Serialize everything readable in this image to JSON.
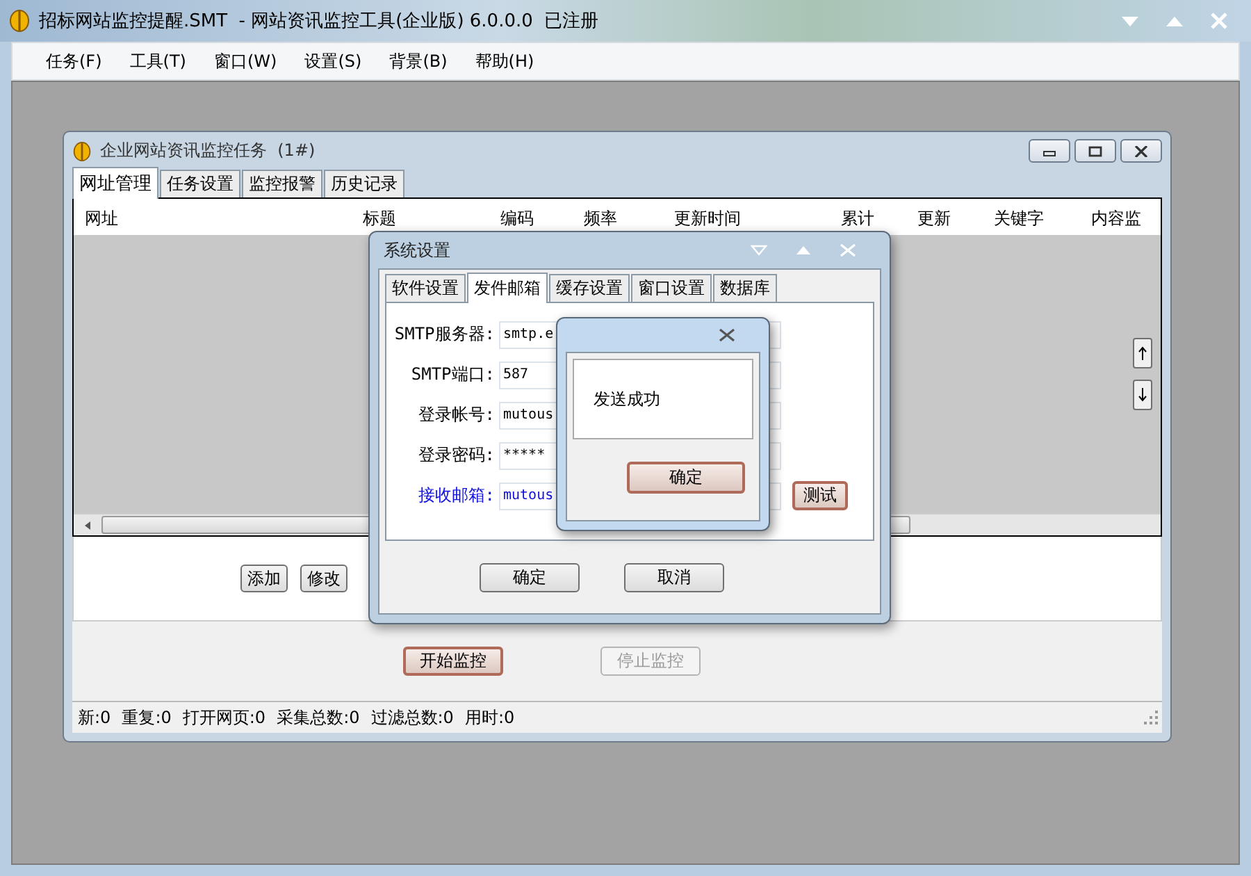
{
  "app": {
    "title": "招标网站监控提醒.SMT  - 网站资讯监控工具(企业版) 6.0.0.0  已注册"
  },
  "menu": [
    "任务(F)",
    "工具(T)",
    "窗口(W)",
    "设置(S)",
    "背景(B)",
    "帮助(H)"
  ],
  "child": {
    "title": "企业网站资讯监控任务  (1#)",
    "tabs": [
      {
        "label": "网址管理",
        "selected": true
      },
      {
        "label": "任务设置",
        "selected": false
      },
      {
        "label": "监控报警",
        "selected": false
      },
      {
        "label": "历史记录",
        "selected": false
      }
    ],
    "columns": [
      "网址",
      "标题",
      "编码",
      "频率",
      "更新时间",
      "累计",
      "更新",
      "关键字",
      "内容监"
    ],
    "row_buttons": [
      "添加",
      "修改"
    ],
    "actions": [
      {
        "label": "开始监控",
        "default": true,
        "disabled": false
      },
      {
        "label": "停止监控",
        "default": false,
        "disabled": true
      }
    ],
    "status": [
      "新:0",
      "重复:0",
      "打开网页:0",
      "采集总数:0",
      "过滤总数:0",
      "用时:0"
    ]
  },
  "dialog": {
    "title": "系统设置",
    "tabs": [
      {
        "label": "软件设置",
        "selected": false
      },
      {
        "label": "发件邮箱",
        "selected": true
      },
      {
        "label": "缓存设置",
        "selected": false
      },
      {
        "label": "窗口设置",
        "selected": false
      },
      {
        "label": "数据库",
        "selected": false
      }
    ],
    "fields": [
      {
        "label": "SMTP服务器:",
        "value": "smtp.e",
        "kind": "text",
        "highlight": false
      },
      {
        "label": "SMTP端口:",
        "value": "587",
        "kind": "select",
        "highlight": false
      },
      {
        "label": "登录帐号:",
        "value": "mutous",
        "kind": "text",
        "highlight": false
      },
      {
        "label": "登录密码:",
        "value": "*****",
        "kind": "text",
        "highlight": false
      },
      {
        "label": "接收邮箱:",
        "value": "mutous",
        "kind": "text",
        "highlight": true
      }
    ],
    "test_button": "测试",
    "buttons": [
      "确定",
      "取消"
    ]
  },
  "message": {
    "text": "发送成功",
    "button": "确定"
  }
}
